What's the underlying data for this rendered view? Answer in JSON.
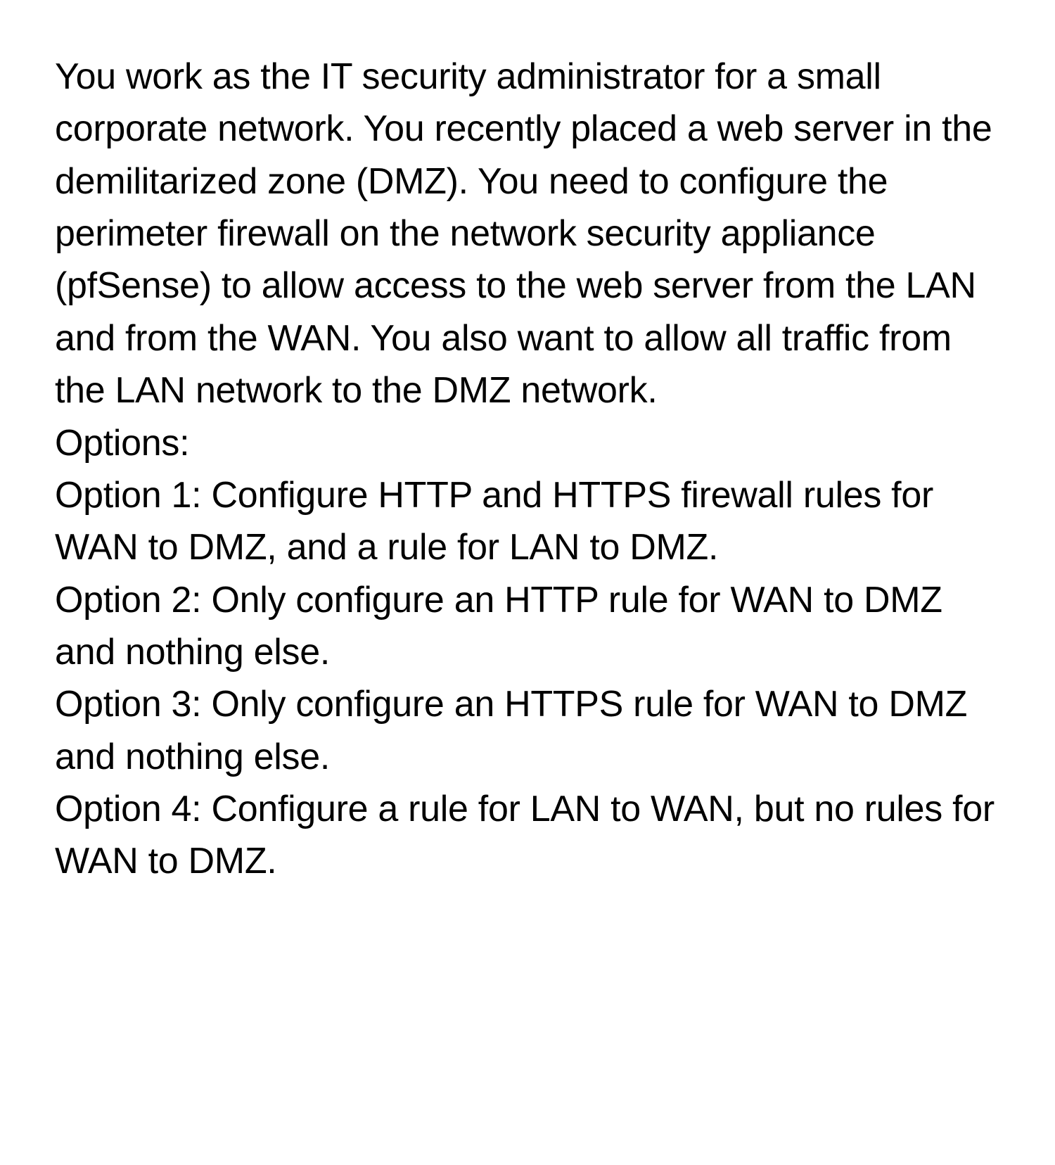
{
  "question": {
    "scenario": "You work as the IT security administrator for a small corporate network. You recently placed a web server in the demilitarized zone (DMZ). You need to configure the perimeter firewall on the network security appliance (pfSense) to allow access to the web server from the LAN and from the WAN. You also want to allow all traffic from the LAN network to the DMZ network.",
    "options_label": "Options:",
    "options": [
      "Option 1: Configure HTTP and HTTPS firewall rules for WAN to DMZ, and a rule for LAN to DMZ.",
      "Option 2: Only configure an HTTP rule for WAN to DMZ and nothing else.",
      "Option 3: Only configure an HTTPS rule for WAN to DMZ and nothing else.",
      "Option 4: Configure a rule for LAN to WAN, but no rules for WAN to DMZ."
    ]
  }
}
